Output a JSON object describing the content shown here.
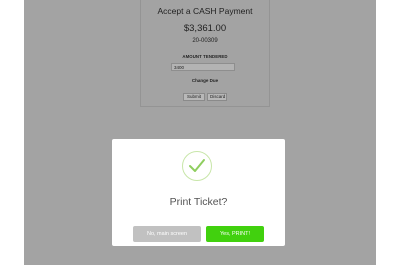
{
  "payment": {
    "title": "Accept a CASH Payment",
    "amount": "$3,361.00",
    "reference": "20-00309",
    "tendered_label": "AMOUNT TENDERED",
    "tendered_value": "3400",
    "change_due_label": "Change Due",
    "submit_label": "Submit",
    "discard_label": "Discard"
  },
  "dialog": {
    "icon": "check-icon",
    "title": "Print Ticket?",
    "no_label": "No, main screen",
    "yes_label": "Yes, PRINT!"
  },
  "colors": {
    "overlay": "#a3a3a3",
    "confirm": "#41d10e",
    "cancel": "#c1c1c1",
    "check": "#8fce5f"
  }
}
